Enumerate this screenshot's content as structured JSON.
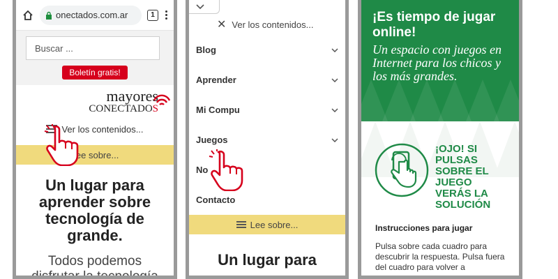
{
  "panel1": {
    "browser": {
      "url": "onectados.com.ar",
      "tab_count": "1"
    },
    "search": {
      "placeholder": "Buscar ..."
    },
    "newsletter_button": "Boletín gratis!",
    "logo": {
      "line1": "mayores",
      "line2_prefix": "CONECTADO",
      "line2_accent": "S"
    },
    "menu_toggle": "Ver los contenidos...",
    "lee_sobre": "Lee sobre...",
    "hero_title": "Un lugar para aprender sobre tecnología de grande.",
    "hero_subtitle": "Todos podemos disfrutar la tecnología"
  },
  "panel2": {
    "close_menu": "Ver los contenidos...",
    "nav_items": [
      {
        "label": "Blog",
        "has_submenu": true
      },
      {
        "label": "Aprender",
        "has_submenu": true
      },
      {
        "label": "Mi Compu",
        "has_submenu": true
      },
      {
        "label": "Juegos",
        "has_submenu": true
      },
      {
        "label": "No",
        "has_submenu": false
      },
      {
        "label": "Contacto",
        "has_submenu": false
      }
    ],
    "lee_sobre": "Lee sobre...",
    "hero_title": "Un lugar para"
  },
  "panel3": {
    "header_title": "¡Es tiempo de jugar online!",
    "header_subtitle": "Un espacio con juegos en Internet para los chicos y los más grandes.",
    "notice": "¡OJO! SI PULSAS SOBRE EL JUEGO VERÁS LA SOLUCIÓN",
    "instructions_title": "Instrucciones para jugar",
    "instructions_text": "Pulsa sobre cada cuadro para descubrir la respuesta. Pulsa fuera del cuadro para volver a"
  },
  "colors": {
    "accent_red": "#d6001c",
    "accent_yellow": "#f0da7d",
    "game_green": "#1f8a47"
  },
  "icons": [
    "home-icon",
    "lock-icon",
    "kebab-menu-icon",
    "wifi-icon",
    "menu-icon",
    "pointing-hand-icon",
    "chevron-down-icon",
    "close-icon",
    "touch-phone-icon"
  ]
}
